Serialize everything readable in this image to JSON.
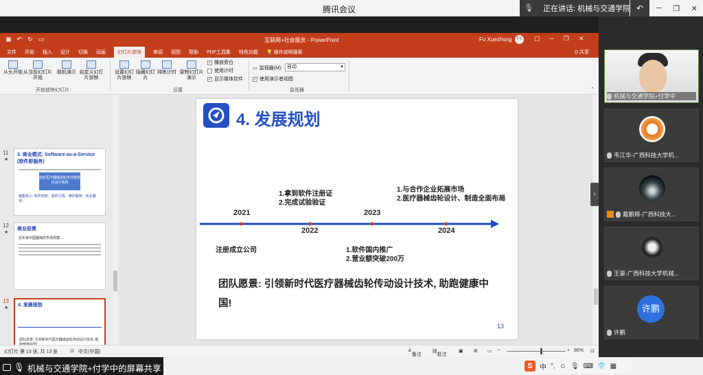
{
  "meeting": {
    "app_title": "腾讯会议",
    "speaking_label": "正在讲话: 机械与交通学院…",
    "back_icon": "undo-icon",
    "share_label": "机械与交通学院+付学中的屏幕共享"
  },
  "ppt": {
    "doc_title": "互联网+社会服务 - PowerPoint",
    "user_name": "Fu Xuezhong",
    "user_initials": "FX",
    "menu_tabs": [
      "文件",
      "开始",
      "插入",
      "设计",
      "切换",
      "动画",
      "幻灯片放映",
      "审阅",
      "视图",
      "帮助",
      "PDF工具集",
      "特色功能",
      "操作说明搜索"
    ],
    "share": "共享",
    "ribbon": {
      "from_start": "从头开始",
      "from_current": "从当前幻灯片开始",
      "online": "联机演示",
      "custom": "自定义幻灯片放映",
      "group1": "开始放映幻灯片",
      "setup": "设置幻灯片放映",
      "hide": "隐藏幻灯片",
      "rehearse": "排练计时",
      "record": "录制幻灯片演示",
      "play_narration": "播放旁白",
      "use_timings": "使用计时",
      "show_media": "显示媒体控件",
      "group2": "设置",
      "monitor_label": "监视器(M):",
      "monitor_value": "自动",
      "presenter_view": "使用演示者视图",
      "group3": "监视器"
    },
    "thumbnails": [
      {
        "num": "11",
        "title": "3. 商业模式: Software-as-a-Service (软件即服务)",
        "img_text": "齿轮医疗器械齿轮传动智能化设计系统",
        "sub": "销售收入: 软件授权、软件订阅、维护服务、专业服务。"
      },
      {
        "num": "12",
        "title": "商业前景",
        "sub": "近年来中国器械的市场规模..."
      },
      {
        "num": "13",
        "title": "4. 发展规划",
        "sub": "团队愿景: 引领新时代医疗器械齿轮传动设计技术, 助跑健康中国!"
      }
    ],
    "slide": {
      "title": "4. 发展规划",
      "years": [
        "2021",
        "2022",
        "2023",
        "2024"
      ],
      "above_2022": [
        "1.拿到软件注册证",
        "2.完成试验验证"
      ],
      "above_2024": [
        "1.与合作企业拓展市场",
        "2.医疗器械齿轮设计、制造全面布局"
      ],
      "below_2021": "注册成立公司",
      "below_2023": [
        "1.软件国内推广",
        "2.营业额突破200万"
      ],
      "vision": "团队愿景: 引领新时代医疗器械齿轮传动设计技术, 助跑健康中国!",
      "page_number": "13",
      "timeline_color": "#1f49c7",
      "accent_color": "#c43e1c"
    },
    "status": {
      "slide_count": "幻灯片 第 13 张, 共 13 张",
      "language": "中文(中国)",
      "notes": "备注",
      "comments": "批注",
      "zoom": "86%"
    }
  },
  "participants": [
    {
      "name": "机械与交通学院+付学中",
      "kind": "video"
    },
    {
      "name": "韦江华-广西科技大学机...",
      "kind": "avatar"
    },
    {
      "name": "戴鹏辉-广西科技大...",
      "kind": "avatar"
    },
    {
      "name": "王豪-广西科技大学机械...",
      "kind": "avatar"
    },
    {
      "name": "许鹏",
      "kind": "text-avatar",
      "avatar_text": "许鹏"
    }
  ],
  "ime": {
    "logo": "S",
    "lang": "中"
  }
}
